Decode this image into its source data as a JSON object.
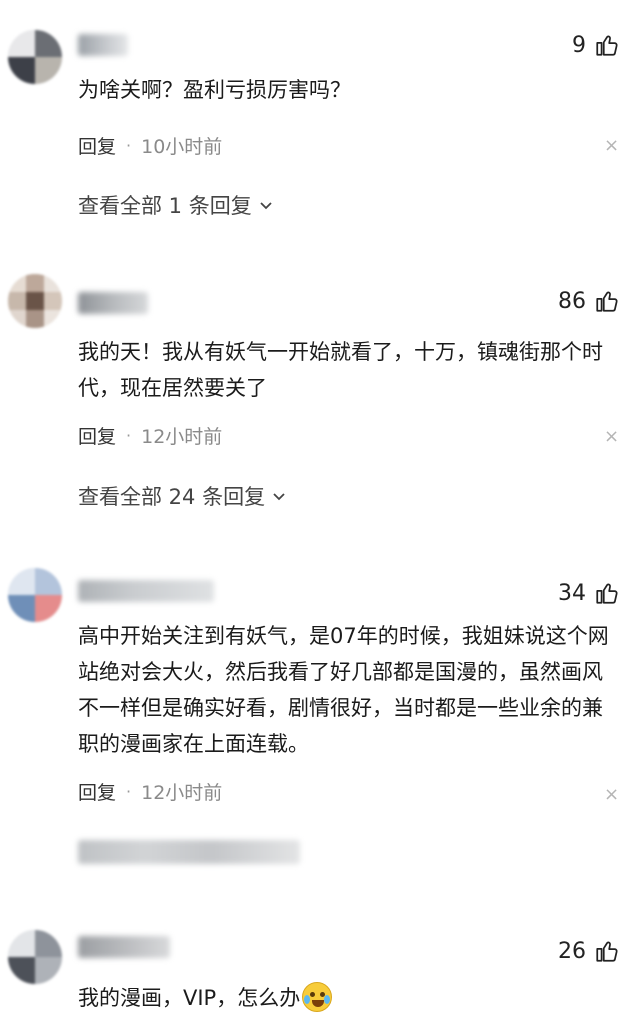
{
  "comments": [
    {
      "likes": "9",
      "text": "为啥关啊？盈利亏损厉害吗？",
      "reply_label": "回复",
      "dot": "·",
      "time": "10小时前",
      "view_replies": "查看全部 1 条回复"
    },
    {
      "likes": "86",
      "text": "我的天！我从有妖气一开始就看了，十万，镇魂街那个时代，现在居然要关了",
      "reply_label": "回复",
      "dot": "·",
      "time": "12小时前",
      "view_replies": "查看全部 24 条回复"
    },
    {
      "likes": "34",
      "text": "高中开始关注到有妖气，是07年的时候，我姐妹说这个网站绝对会大火，然后我看了好几部都是国漫的，虽然画风不一样但是确实好看，剧情很好，当时都是一些业余的兼职的漫画家在上面连载。",
      "reply_label": "回复",
      "dot": "·",
      "time": "12小时前"
    },
    {
      "likes": "26",
      "text": "我的漫画，VIP，怎么办"
    }
  ],
  "icons": {
    "like": "thumbs-up-icon",
    "close": "close-icon",
    "chevron": "chevron-down-icon",
    "emoji": "crying-laughing-emoji"
  },
  "close_glyph": "×"
}
